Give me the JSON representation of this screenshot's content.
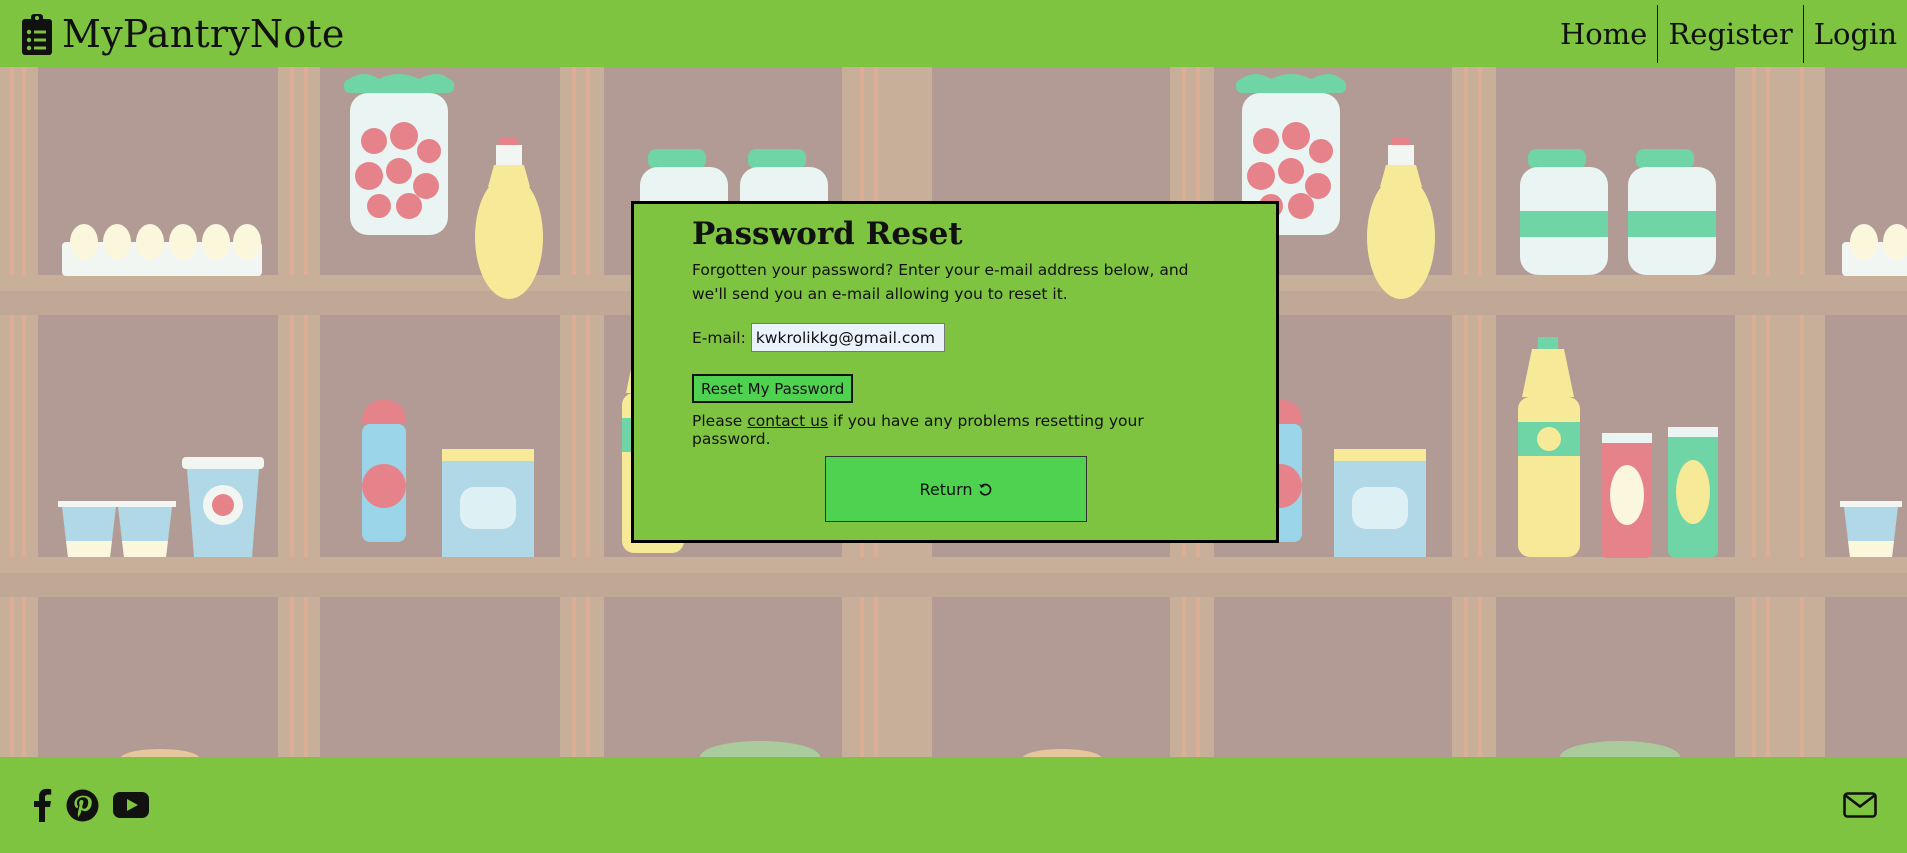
{
  "header": {
    "brand": "MyPantryNote",
    "brand_icon": "clipboard-list-icon",
    "nav": [
      {
        "label": "Home"
      },
      {
        "label": "Register"
      },
      {
        "label": "Login"
      }
    ]
  },
  "modal": {
    "title": "Password Reset",
    "description": "Forgotten your password? Enter your e-mail address below, and we'll send you an e-mail allowing you to reset it.",
    "email_label": "E-mail:",
    "email_value": "kwkrolikkg@gmail.com",
    "reset_button": "Reset My Password",
    "contact_prefix": "Please ",
    "contact_link": "contact us",
    "contact_suffix": " if you have any problems resetting your password.",
    "return_button": "Return",
    "return_icon": "rotate-left-icon"
  },
  "footer": {
    "social_icons": [
      "facebook-icon",
      "pinterest-icon",
      "youtube-icon"
    ],
    "mail_icon": "envelope-icon"
  },
  "colors": {
    "header_footer": "#7ec440",
    "button_green": "#4fd24f",
    "pantry_wall": "#a88e86",
    "shelf": "#c0a48c"
  }
}
